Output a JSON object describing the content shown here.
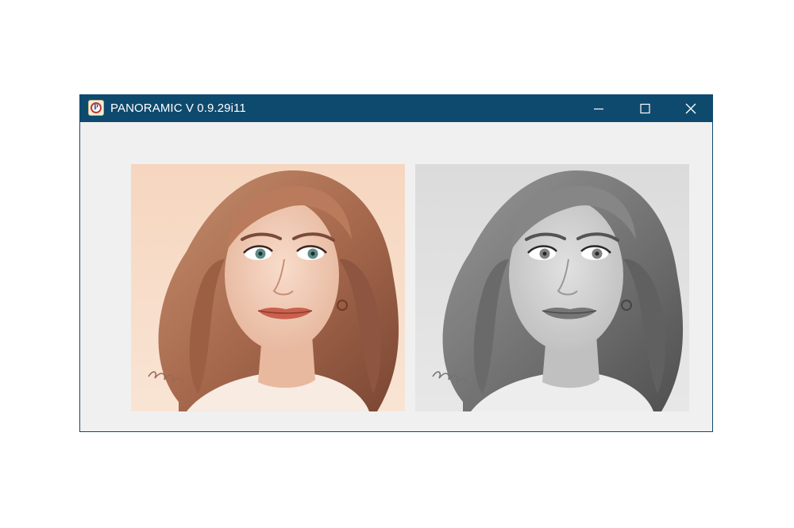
{
  "window": {
    "title": "PANORAMIC V 0.9.29i11",
    "app_icon_letter": "P",
    "controls": {
      "minimize_icon": "minimize-icon",
      "maximize_icon": "maximize-icon",
      "close_icon": "close-icon"
    },
    "titlebar_color": "#0e4a6e",
    "client_color": "#f0f0f0"
  },
  "images": [
    {
      "name": "color-portrait",
      "depicts": "portrait-original",
      "signature": "Bezwas"
    },
    {
      "name": "grayscale-portrait",
      "depicts": "portrait-grayscale",
      "signature": "Bezwas"
    }
  ]
}
